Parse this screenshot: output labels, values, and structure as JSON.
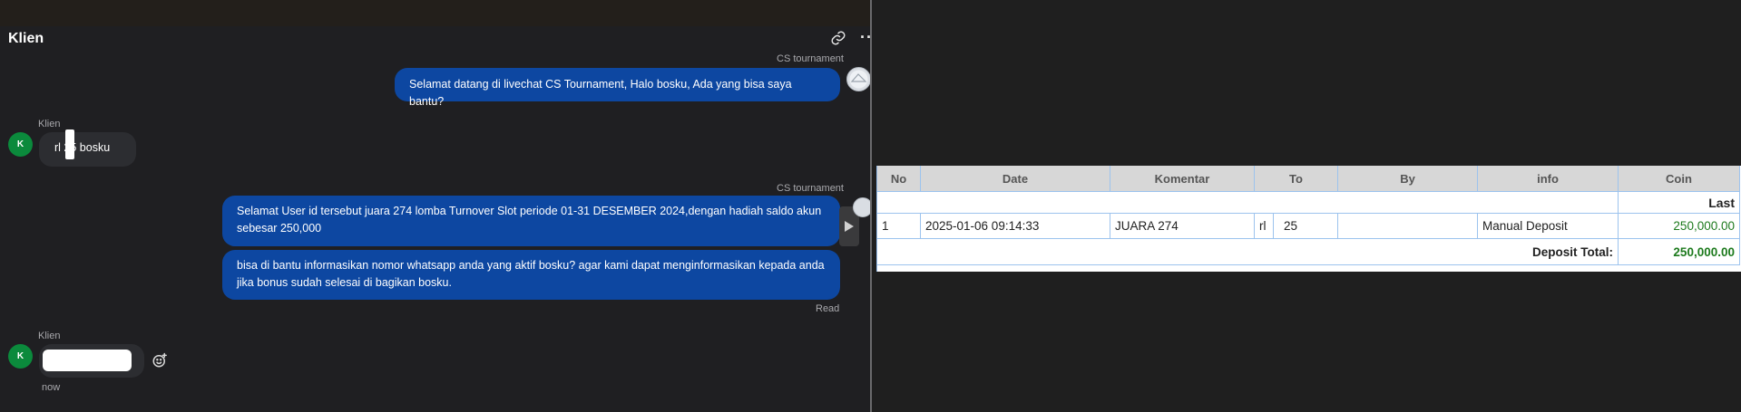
{
  "chat": {
    "title": "Klien",
    "header_icons": [
      "link-icon",
      "more-icon"
    ],
    "messages": [
      {
        "sender": "CS tournament",
        "role": "agent",
        "text": "Selamat datang di livechat CS Tournament, Halo bosku, Ada yang bisa saya bantu?"
      },
      {
        "sender": "Klien",
        "role": "client",
        "avatar": "K",
        "text": "rl 25 bosku"
      },
      {
        "sender": "CS tournament",
        "role": "agent",
        "text": "Selamat User id tersebut juara 274 lomba Turnover Slot periode 01-31 DESEMBER 2024,dengan hadiah saldo akun sebesar 250,000"
      },
      {
        "role": "agent",
        "text": "bisa di bantu informasikan nomor whatsapp anda yang aktif bosku? agar kami dapat menginformasikan kepada anda jika bonus sudah selesai di bagikan bosku.",
        "status": "Read"
      },
      {
        "sender": "Klien",
        "role": "client",
        "avatar": "K",
        "text": "",
        "time": "now"
      }
    ]
  },
  "table": {
    "columns": [
      "No",
      "Date",
      "Komentar",
      "To",
      "By",
      "info",
      "Coin"
    ],
    "last_label": "Last",
    "rows": [
      {
        "no": "1",
        "date": "2025-01-06 09:14:33",
        "komentar": "JUARA 274",
        "to_prefix": "rl",
        "to_suffix": "25",
        "by": "",
        "info": "Manual Deposit",
        "coin": "250,000.00"
      }
    ],
    "total_label": "Deposit Total:",
    "total_value": "250,000.00"
  },
  "colors": {
    "agent_bubble": "#0d47a1",
    "client_bubble": "#2c2d31",
    "client_avatar": "#0b8a3c",
    "coin_green": "#1d7a1d"
  }
}
